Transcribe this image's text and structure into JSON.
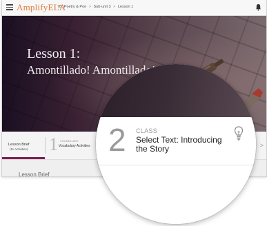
{
  "topbar": {
    "logo": "AmplifyELA",
    "breadcrumb": [
      "7B: Poetry & Poe",
      "Sub-unit 3",
      "Lesson 1"
    ],
    "breadcrumb_sep": ">",
    "accent_color": "#e07b39"
  },
  "hero": {
    "lesson_number": "Lesson 1:",
    "title": "Amontillado! Amontillado!"
  },
  "tabs": {
    "brief_label": "Lesson Brief",
    "brief_sub": "(11 Activities)",
    "activity_number": "1",
    "activity_category": "VOCABULARY",
    "activity_name": "Vocabulary Activities",
    "next_arrow": ">",
    "active_color": "#7d1f52"
  },
  "section": {
    "heading": "Lesson Brief"
  },
  "magnifier": {
    "number": "2",
    "category": "CLASS",
    "title": "Select Text: Introducing the Story",
    "icon": "lightbulb-icon"
  }
}
